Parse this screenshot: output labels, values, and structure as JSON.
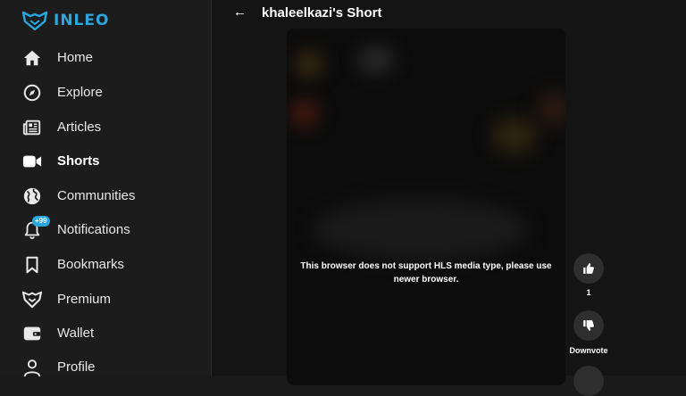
{
  "brand": {
    "name": "INLEO",
    "accent": "#2aa7e0"
  },
  "sidebar": {
    "items": [
      {
        "label": "Home",
        "icon": "home-icon"
      },
      {
        "label": "Explore",
        "icon": "compass-icon"
      },
      {
        "label": "Articles",
        "icon": "newspaper-icon"
      },
      {
        "label": "Shorts",
        "icon": "video-camera-icon",
        "active": true
      },
      {
        "label": "Communities",
        "icon": "globe-icon"
      },
      {
        "label": "Notifications",
        "icon": "bell-icon",
        "badge": "+99"
      },
      {
        "label": "Bookmarks",
        "icon": "bookmark-icon"
      },
      {
        "label": "Premium",
        "icon": "premium-logo-icon"
      },
      {
        "label": "Wallet",
        "icon": "wallet-icon"
      },
      {
        "label": "Profile",
        "icon": "user-icon"
      }
    ]
  },
  "header": {
    "back": "←",
    "title": "khaleelkazi's Short"
  },
  "video": {
    "message": "This browser does not support HLS media type, please use newer browser."
  },
  "actions": {
    "upvote_count": "1",
    "downvote_label": "Downvote"
  }
}
